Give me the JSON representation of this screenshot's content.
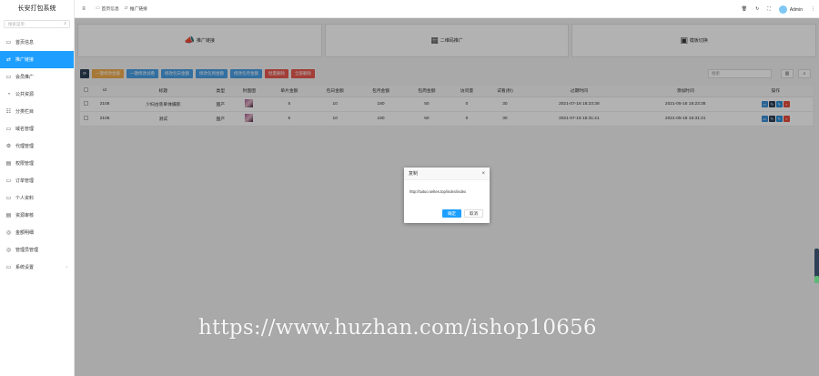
{
  "brand": "长安打包系统",
  "side_search_placeholder": "搜索菜单",
  "sidebar": [
    {
      "label": "首页信息",
      "icon": "home-icon",
      "active": false
    },
    {
      "label": "推广链接",
      "icon": "link-icon",
      "active": true
    },
    {
      "label": "会员推广",
      "icon": "users-icon",
      "active": false
    },
    {
      "label": "公共资源",
      "icon": "resource-icon",
      "active": false
    },
    {
      "label": "分类栏目",
      "icon": "category-icon",
      "active": false
    },
    {
      "label": "域名管理",
      "icon": "domain-icon",
      "active": false
    },
    {
      "label": "代理管理",
      "icon": "agent-icon",
      "active": false
    },
    {
      "label": "权限管理",
      "icon": "permission-icon",
      "active": false
    },
    {
      "label": "订单管理",
      "icon": "order-icon",
      "active": false
    },
    {
      "label": "个人资料",
      "icon": "profile-icon",
      "active": false
    },
    {
      "label": "资源审核",
      "icon": "review-icon",
      "active": false
    },
    {
      "label": "金额明细",
      "icon": "money-icon",
      "active": false
    },
    {
      "label": "管理员管理",
      "icon": "admin-icon",
      "active": false
    },
    {
      "label": "系统设置",
      "icon": "settings-icon",
      "active": false,
      "has_arrow": true
    }
  ],
  "topbar": {
    "tabs": [
      {
        "label": "首页信息",
        "icon": "home-tab-icon"
      },
      {
        "label": "推广链接",
        "icon": "link-tab-icon"
      }
    ],
    "admin_label": "Admin"
  },
  "cards": [
    {
      "label": "推广链接",
      "icon": "megaphone-icon"
    },
    {
      "label": "二维码推广",
      "icon": "qrcode-icon"
    },
    {
      "label": "模板切换",
      "icon": "template-icon"
    }
  ],
  "toolbar": {
    "refresh": "⟳",
    "buttons": [
      {
        "label": "一键修改金额",
        "color": "orange"
      },
      {
        "label": "一键修改试看",
        "color": "blue"
      },
      {
        "label": "修改包日金额",
        "color": "blue"
      },
      {
        "label": "修改包周金额",
        "color": "blue"
      },
      {
        "label": "修改包月金额",
        "color": "blue"
      },
      {
        "label": "批量删除",
        "color": "red"
      },
      {
        "label": "全部删除",
        "color": "red"
      }
    ],
    "search_placeholder": "搜索"
  },
  "table": {
    "headers": [
      "",
      "id",
      "标题",
      "类型",
      "封面图",
      "单片金额",
      "包日金额",
      "包月金额",
      "包周金额",
      "访问量",
      "试看(秒)",
      "过期时间",
      "添加时间",
      "操作"
    ],
    "rows": [
      {
        "id": "2106",
        "title": "少妇古装单体摄影",
        "type": "国产",
        "single": "5",
        "day": "10",
        "month": "180",
        "week": "50",
        "views": "0",
        "trial": "30",
        "expire": "2021-07-18 18:23:38",
        "added": "2021-05-18 18:23:38"
      },
      {
        "id": "2105",
        "title": "测试",
        "type": "国产",
        "single": "5",
        "day": "10",
        "month": "180",
        "week": "50",
        "views": "0",
        "trial": "30",
        "expire": "2021-07-18 15:31:21",
        "added": "2021-05-18 15:31:21"
      }
    ]
  },
  "dialog": {
    "title": "复制",
    "url": "http://tuituo.seltes.top/index/index",
    "confirm": "确定",
    "cancel": "取消"
  },
  "watermark": "https://www.huzhan.com/ishop10656"
}
